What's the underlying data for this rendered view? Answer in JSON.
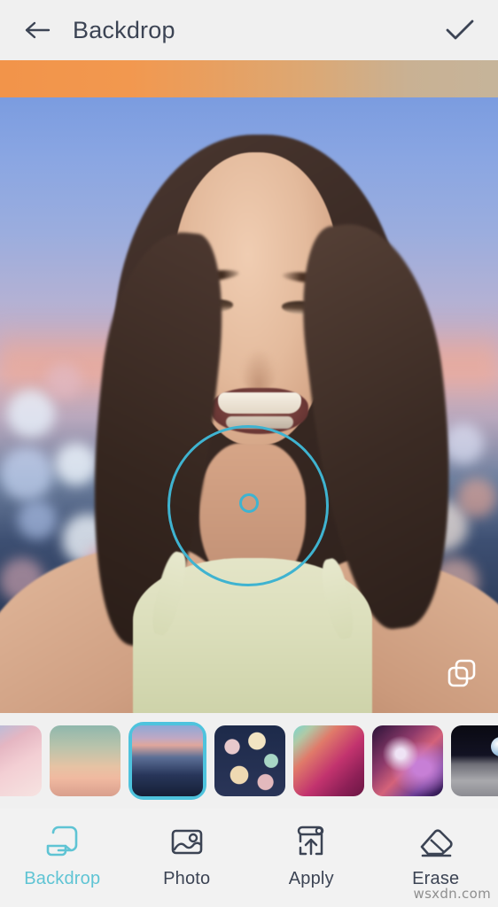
{
  "header": {
    "back_icon": "arrow-left-icon",
    "title": "Backdrop",
    "confirm_icon": "check-icon"
  },
  "canvas": {
    "layers_icon": "layers-copy-icon",
    "brush_ring_label": "brush-size-ring",
    "brush_cursor_label": "brush-cursor"
  },
  "thumbnails": {
    "selected_index": 2,
    "items": [
      {
        "name": "pink-blur-backdrop",
        "style": "t-pinkblur",
        "selected": false
      },
      {
        "name": "sunset-sky-backdrop",
        "style": "t-sunset",
        "selected": false
      },
      {
        "name": "city-lights-backdrop",
        "style": "t-citylights",
        "selected": true
      },
      {
        "name": "bokeh-lights-backdrop",
        "style": "t-bokeh",
        "selected": false
      },
      {
        "name": "magenta-paint-backdrop",
        "style": "t-magenta",
        "selected": false
      },
      {
        "name": "nebula-backdrop",
        "style": "t-nebula",
        "selected": false
      },
      {
        "name": "moon-earth-backdrop",
        "style": "t-moon",
        "selected": false
      }
    ]
  },
  "tabbar": {
    "active": "Backdrop",
    "tabs": [
      {
        "label": "Backdrop",
        "icon": "backdrop-roll-icon",
        "active": true
      },
      {
        "label": "Photo",
        "icon": "image-icon",
        "active": false
      },
      {
        "label": "Apply",
        "icon": "apply-upload-icon",
        "active": false
      },
      {
        "label": "Erase",
        "icon": "eraser-icon",
        "active": false
      }
    ]
  },
  "watermark": {
    "text": "wsxdn.com"
  },
  "colors": {
    "accent": "#5fc4d4",
    "brush": "#3fb3d0",
    "selected_border": "#4ec3dd",
    "header_bg": "#f0f0f0",
    "text": "#3c4454",
    "orange_strip": "#f2944a"
  }
}
